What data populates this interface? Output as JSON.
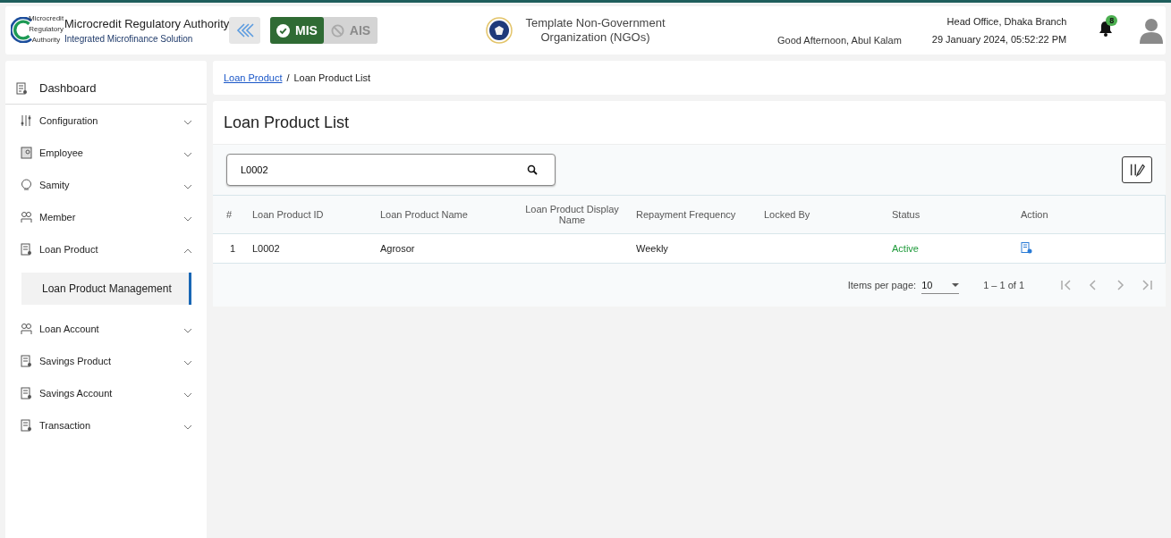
{
  "header": {
    "logo_lines": [
      "Microcredit",
      "Regulatory",
      "Authority"
    ],
    "title": "Microcredit Regulatory Authority",
    "subtitle": "Integrated Microfinance Solution",
    "modules": [
      {
        "label": "MIS",
        "selected": true
      },
      {
        "label": "AIS",
        "selected": false
      }
    ],
    "organization": "Template Non-Government Organization (NGOs)",
    "greeting": "Good Afternoon, Abul Kalam",
    "branch": "Head Office, Dhaka Branch",
    "datetime": "29 January 2024, 05:52:22 PM",
    "notification_count": "8"
  },
  "sidebar": {
    "dashboard": "Dashboard",
    "items": [
      {
        "label": "Configuration",
        "kind": "sliders",
        "expanded": false
      },
      {
        "label": "Employee",
        "kind": "badge",
        "expanded": false
      },
      {
        "label": "Samity",
        "kind": "group",
        "expanded": false
      },
      {
        "label": "Member",
        "kind": "people",
        "expanded": false
      },
      {
        "label": "Loan Product",
        "kind": "doc",
        "expanded": true,
        "children": [
          {
            "label": "Loan Product Management",
            "selected": true
          }
        ]
      },
      {
        "label": "Loan Account",
        "kind": "people",
        "expanded": false
      },
      {
        "label": "Savings Product",
        "kind": "doc",
        "expanded": false
      },
      {
        "label": "Savings Account",
        "kind": "doc",
        "expanded": false
      },
      {
        "label": "Transaction",
        "kind": "doc",
        "expanded": false
      }
    ]
  },
  "breadcrumb": {
    "link": "Loan Product",
    "separator": "/",
    "current": "Loan Product List"
  },
  "page_title": "Loan Product List",
  "search": {
    "value": "L0002"
  },
  "table": {
    "columns": [
      "#",
      "Loan Product ID",
      "Loan Product Name",
      "Loan Product Display Name",
      "Repayment Frequency",
      "Locked By",
      "Status",
      "Action"
    ],
    "rows": [
      {
        "cells": [
          "1",
          "L0002",
          "Agrosor",
          "",
          "Weekly",
          ""
        ],
        "status": "Active"
      }
    ]
  },
  "pagination": {
    "label": "Items per page:",
    "page_size": "10",
    "range": "1 – 1 of 1"
  }
}
